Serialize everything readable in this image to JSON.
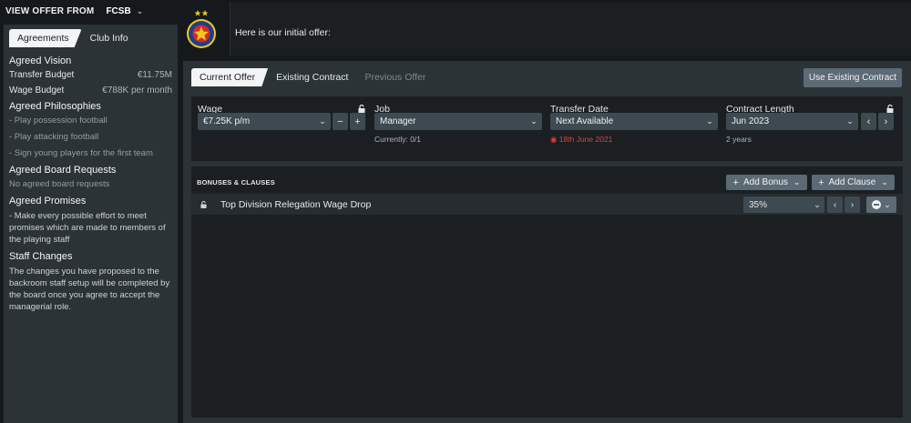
{
  "header": {
    "view_offer_from": "VIEW OFFER FROM",
    "club": "FCSB",
    "message": "Here is our initial offer:"
  },
  "left": {
    "tabs": [
      {
        "label": "Agreements",
        "active": true
      },
      {
        "label": "Club Info",
        "active": false
      }
    ],
    "vision": {
      "title": "Agreed Vision",
      "transfer_budget_label": "Transfer Budget",
      "transfer_budget_value": "€11.75M",
      "wage_budget_label": "Wage Budget",
      "wage_budget_value": "€788K per month"
    },
    "philosophies": {
      "title": "Agreed Philosophies",
      "items": [
        "- Play possession football",
        "- Play attacking football",
        "- Sign young players for the first team"
      ]
    },
    "board": {
      "title": "Agreed Board Requests",
      "text": "No agreed board requests"
    },
    "promises": {
      "title": "Agreed Promises",
      "text": "- Make every possible effort to meet promises which are made to members of the playing staff"
    },
    "staff": {
      "title": "Staff Changes",
      "text": "The changes you have proposed to the backroom staff setup will be completed by the board once you agree to accept the managerial role."
    }
  },
  "main": {
    "tabs": [
      {
        "label": "Current Offer"
      },
      {
        "label": "Existing Contract"
      },
      {
        "label": "Previous Offer"
      }
    ],
    "use_existing": "Use Existing Contract",
    "wage": {
      "label": "Wage",
      "value": "€7.25K p/m"
    },
    "job": {
      "label": "Job",
      "value": "Manager",
      "sub": "Currently: 0/1"
    },
    "transfer_date": {
      "label": "Transfer Date",
      "value": "Next Available",
      "sub": "18th June 2021"
    },
    "contract_length": {
      "label": "Contract Length",
      "value": "Jun 2023",
      "sub": "2 years"
    },
    "bonuses": {
      "title": "BONUSES & CLAUSES",
      "add_bonus": "Add Bonus",
      "add_clause": "Add Clause",
      "row_label": "Top Division Relegation Wage Drop",
      "row_value": "35%"
    }
  },
  "colors": {
    "accent": "#5b6a74",
    "warning": "#e0403a"
  }
}
